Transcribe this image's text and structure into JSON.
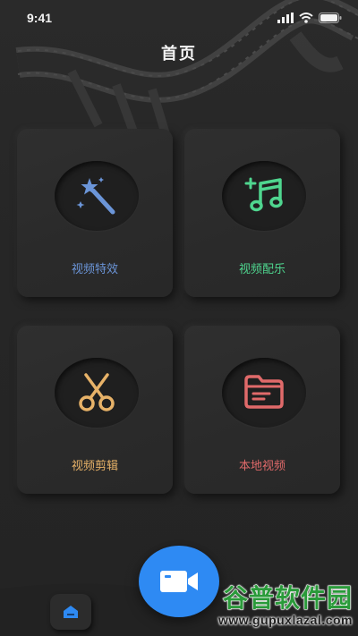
{
  "status_bar": {
    "time": "9:41"
  },
  "header": {
    "title": "首页"
  },
  "cards": [
    {
      "label": "视频特效",
      "color": "#6b95d8",
      "icon": "magic-wand-icon"
    },
    {
      "label": "视频配乐",
      "color": "#4fd68f",
      "icon": "music-note-icon"
    },
    {
      "label": "视频剪辑",
      "color": "#e7b268",
      "icon": "scissors-icon"
    },
    {
      "label": "本地视频",
      "color": "#e06a6a",
      "icon": "folder-icon"
    }
  ],
  "bottom_nav": {
    "home_icon": "home-icon",
    "record_icon": "video-camera-icon",
    "accent": "#2e8af3"
  },
  "watermark": {
    "title": "谷普软件园",
    "url": "www.gupuxlazal.com"
  }
}
